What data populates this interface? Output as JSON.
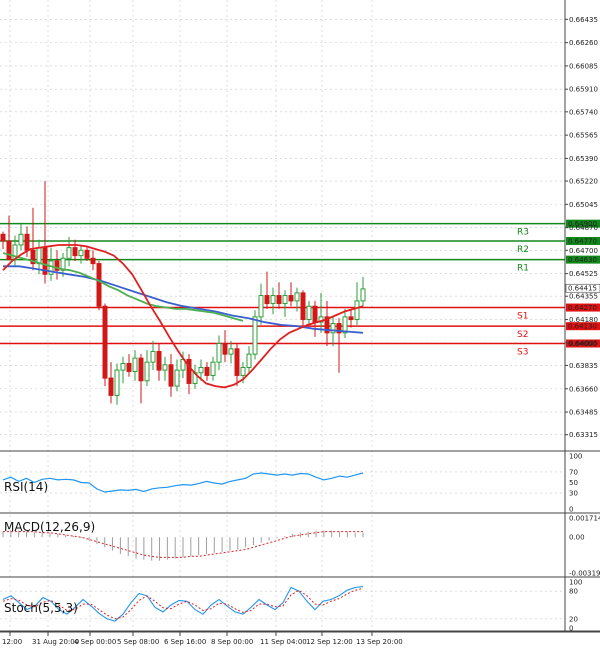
{
  "colors": {
    "resistance": "#11881a",
    "support": "#e01010",
    "ma_fast": "#e02020",
    "ma_mid": "#4caf50",
    "ma_slow": "#3a5fcf",
    "up": "#2e9e3a",
    "down": "#d01818",
    "rsi": "#2196f3",
    "macd_signal": "#e02020",
    "macd_hist": "#9e9e9e",
    "stoch_k": "#2196f3",
    "stoch_d": "#e02020"
  },
  "chart_data": [
    {
      "type": "candlestick",
      "panel": "price",
      "y_ticks": [
        "0.66435",
        "0.66260",
        "0.66085",
        "0.65910",
        "0.65740",
        "0.65565",
        "0.65390",
        "0.65220",
        "0.65045",
        "0.64870",
        "0.64700",
        "0.64525",
        "0.64355",
        "0.64180",
        "0.64005",
        "0.63835",
        "0.63660",
        "0.63485",
        "0.63315"
      ],
      "ylim": [
        0.6323,
        0.6652
      ],
      "x_ticks": [
        "12:00",
        "31 Aug 20:00",
        "4 Sep 00:00",
        "5 Sep 08:00",
        "6 Sep 16:00",
        "8 Sep 00:00",
        "11 Sep 04:00",
        "12 Sep 12:00",
        "13 Sep 20:00"
      ],
      "levels": [
        {
          "label": "R3",
          "value": 0.649,
          "tag": "0.64900",
          "kind": "resistance"
        },
        {
          "label": "R2",
          "value": 0.6477,
          "tag": "0.64770",
          "kind": "resistance"
        },
        {
          "label": "R1",
          "value": 0.6463,
          "tag": "0.64630",
          "kind": "resistance"
        },
        {
          "label": "S1",
          "value": 0.6427,
          "tag": "0.64270",
          "kind": "support"
        },
        {
          "label": "S2",
          "value": 0.6413,
          "tag": "0.64130",
          "kind": "support"
        },
        {
          "label": "S3",
          "value": 0.64,
          "tag": "0.64000",
          "kind": "support"
        }
      ],
      "last_price": {
        "value": 0.64415,
        "tag": "0.64415"
      },
      "candles": [
        [
          0.6482,
          0.6484,
          0.6471,
          0.6477
        ],
        [
          0.6477,
          0.6496,
          0.6468,
          0.6463
        ],
        [
          0.6463,
          0.6481,
          0.6458,
          0.6474
        ],
        [
          0.6474,
          0.649,
          0.647,
          0.6482
        ],
        [
          0.6482,
          0.6488,
          0.6465,
          0.647
        ],
        [
          0.647,
          0.6502,
          0.6455,
          0.646
        ],
        [
          0.646,
          0.6478,
          0.6452,
          0.6472
        ],
        [
          0.6472,
          0.6522,
          0.6445,
          0.6452
        ],
        [
          0.6452,
          0.6472,
          0.6447,
          0.6462
        ],
        [
          0.6462,
          0.647,
          0.6448,
          0.6455
        ],
        [
          0.6455,
          0.6468,
          0.645,
          0.6464
        ],
        [
          0.6464,
          0.648,
          0.6458,
          0.6472
        ],
        [
          0.6472,
          0.6478,
          0.6462,
          0.6466
        ],
        [
          0.6466,
          0.6474,
          0.646,
          0.647
        ],
        [
          0.647,
          0.6472,
          0.6462,
          0.6464
        ],
        [
          0.6464,
          0.647,
          0.6455,
          0.646
        ],
        [
          0.646,
          0.6462,
          0.6425,
          0.6428
        ],
        [
          0.6428,
          0.643,
          0.6368,
          0.6374
        ],
        [
          0.6374,
          0.6386,
          0.6355,
          0.6361
        ],
        [
          0.6361,
          0.6385,
          0.6354,
          0.638
        ],
        [
          0.638,
          0.639,
          0.637,
          0.6385
        ],
        [
          0.6385,
          0.6392,
          0.6375,
          0.6379
        ],
        [
          0.6379,
          0.6395,
          0.6372,
          0.6389
        ],
        [
          0.6389,
          0.6392,
          0.6355,
          0.6372
        ],
        [
          0.6372,
          0.6395,
          0.6368,
          0.6386
        ],
        [
          0.6386,
          0.6402,
          0.638,
          0.6394
        ],
        [
          0.6394,
          0.64,
          0.6372,
          0.638
        ],
        [
          0.638,
          0.639,
          0.6372,
          0.6384
        ],
        [
          0.6384,
          0.6392,
          0.636,
          0.6368
        ],
        [
          0.6368,
          0.6388,
          0.6364,
          0.638
        ],
        [
          0.638,
          0.6394,
          0.6374,
          0.6388
        ],
        [
          0.6388,
          0.6392,
          0.6362,
          0.637
        ],
        [
          0.637,
          0.6384,
          0.6366,
          0.6378
        ],
        [
          0.6378,
          0.6388,
          0.6372,
          0.6382
        ],
        [
          0.6382,
          0.6386,
          0.6372,
          0.6376
        ],
        [
          0.6376,
          0.639,
          0.6372,
          0.6386
        ],
        [
          0.6386,
          0.6406,
          0.638,
          0.64
        ],
        [
          0.64,
          0.641,
          0.6386,
          0.6392
        ],
        [
          0.6392,
          0.6402,
          0.6385,
          0.6396
        ],
        [
          0.6396,
          0.64,
          0.6368,
          0.6376
        ],
        [
          0.6376,
          0.6386,
          0.637,
          0.6382
        ],
        [
          0.6382,
          0.6398,
          0.6378,
          0.6392
        ],
        [
          0.6392,
          0.6425,
          0.6388,
          0.642
        ],
        [
          0.642,
          0.6445,
          0.6414,
          0.6436
        ],
        [
          0.6436,
          0.6454,
          0.6426,
          0.643
        ],
        [
          0.643,
          0.6442,
          0.6422,
          0.6436
        ],
        [
          0.6436,
          0.6446,
          0.6426,
          0.643
        ],
        [
          0.643,
          0.644,
          0.642,
          0.6436
        ],
        [
          0.6436,
          0.6446,
          0.6428,
          0.6432
        ],
        [
          0.6432,
          0.6442,
          0.6424,
          0.6438
        ],
        [
          0.6438,
          0.644,
          0.6412,
          0.6418
        ],
        [
          0.6418,
          0.6432,
          0.6414,
          0.6428
        ],
        [
          0.6428,
          0.6432,
          0.6405,
          0.6416
        ],
        [
          0.6416,
          0.6438,
          0.6408,
          0.642
        ],
        [
          0.642,
          0.6432,
          0.6398,
          0.6408
        ],
        [
          0.6408,
          0.642,
          0.6398,
          0.6415
        ],
        [
          0.6415,
          0.6419,
          0.6378,
          0.6408
        ],
        [
          0.6408,
          0.6426,
          0.6404,
          0.642
        ],
        [
          0.642,
          0.6426,
          0.6412,
          0.6418
        ],
        [
          0.6418,
          0.6446,
          0.6414,
          0.6432
        ],
        [
          0.6432,
          0.645,
          0.6428,
          0.6441
        ]
      ],
      "ma_fast": [
        0.6455,
        0.6462,
        0.6467,
        0.6471,
        0.6472,
        0.6473,
        0.6474,
        0.6474,
        0.6474,
        0.6473,
        0.6471,
        0.6469,
        0.6466,
        0.646,
        0.6452,
        0.644,
        0.6428,
        0.6417,
        0.6405,
        0.6394,
        0.6384,
        0.6376,
        0.637,
        0.6368,
        0.6367,
        0.6369,
        0.6373,
        0.638,
        0.6388,
        0.6396,
        0.6403,
        0.6408,
        0.6411,
        0.6414,
        0.6416,
        0.6418,
        0.6421,
        0.6424,
        0.6426,
        0.6428
      ],
      "ma_mid": [
        0.6468,
        0.6466,
        0.6464,
        0.6462,
        0.646,
        0.6458,
        0.6456,
        0.6455,
        0.6453,
        0.645,
        0.6447,
        0.6443,
        0.644,
        0.6436,
        0.6433,
        0.643,
        0.6428,
        0.6427,
        0.6426,
        0.6426,
        0.6425,
        0.6424,
        0.6423,
        0.6421,
        0.6419,
        0.6417
      ],
      "ma_slow": [
        0.6458,
        0.6458,
        0.6456,
        0.6454,
        0.6452,
        0.645,
        0.6447,
        0.6443,
        0.6439,
        0.6435,
        0.6431,
        0.6428,
        0.6426,
        0.6424,
        0.6421,
        0.6419,
        0.6416,
        0.6414,
        0.6413,
        0.6411,
        0.641,
        0.6409,
        0.6408
      ]
    },
    {
      "type": "line",
      "panel": "rsi",
      "name": "RSI(14)",
      "y_ticks": [
        "100",
        "70",
        "50",
        "30",
        "0"
      ],
      "ylim": [
        0,
        100
      ],
      "values": [
        55,
        60,
        52,
        58,
        50,
        56,
        58,
        55,
        56,
        55,
        50,
        49,
        38,
        32,
        34,
        36,
        35,
        37,
        33,
        38,
        40,
        41,
        44,
        46,
        45,
        48,
        52,
        49,
        47,
        52,
        55,
        58,
        66,
        68,
        66,
        64,
        66,
        64,
        67,
        66,
        60,
        55,
        58,
        62,
        60,
        64,
        68
      ]
    },
    {
      "type": "bar+line",
      "panel": "macd",
      "name": "MACD(12,26,9)",
      "y_ticks": [
        "0.001714",
        "0.00",
        "-0.003195"
      ],
      "ylim": [
        -0.003195,
        0.001714
      ],
      "histogram": [
        0.0005,
        0.0006,
        0.0006,
        0.0005,
        0.0005,
        0.0004,
        0.0004,
        0.0003,
        0.0002,
        0.0001,
        -0.0001,
        -0.0003,
        -0.0006,
        -0.0009,
        -0.0012,
        -0.0015,
        -0.0017,
        -0.0019,
        -0.002,
        -0.0021,
        -0.0021,
        -0.002,
        -0.0019,
        -0.0018,
        -0.0017,
        -0.0016,
        -0.0015,
        -0.0014,
        -0.0013,
        -0.0012,
        -0.0011,
        -0.0009,
        -0.0007,
        -0.0005,
        -0.0003,
        -0.0001,
        0.0001,
        0.0003,
        0.0004,
        0.0005,
        0.0006,
        0.0006,
        0.0006,
        0.0005,
        0.0005,
        0.0004,
        0.0004
      ],
      "signal": [
        0.0005,
        0.0005,
        0.0005,
        0.0005,
        0.0005,
        0.0004,
        0.0004,
        0.0003,
        0.0002,
        0.0001,
        0.0,
        -0.0002,
        -0.0004,
        -0.0006,
        -0.0008,
        -0.001,
        -0.0012,
        -0.0014,
        -0.0016,
        -0.0017,
        -0.0018,
        -0.0018,
        -0.0018,
        -0.0018,
        -0.0017,
        -0.0017,
        -0.0016,
        -0.0015,
        -0.0014,
        -0.0013,
        -0.0012,
        -0.0011,
        -0.0009,
        -0.0007,
        -0.0005,
        -0.0003,
        -0.0001,
        0.0001,
        0.0002,
        0.0003,
        0.0004,
        0.0005,
        0.0005,
        0.0005,
        0.0005,
        0.0005,
        0.0005
      ]
    },
    {
      "type": "line",
      "panel": "stoch",
      "name": "Stoch(5,5,3)",
      "y_ticks": [
        "100",
        "80",
        "20",
        "0"
      ],
      "ylim": [
        0,
        100
      ],
      "k": [
        62,
        70,
        55,
        40,
        48,
        66,
        58,
        40,
        30,
        45,
        62,
        48,
        32,
        20,
        15,
        30,
        55,
        75,
        70,
        45,
        35,
        50,
        60,
        58,
        40,
        30,
        50,
        62,
        48,
        35,
        30,
        45,
        62,
        50,
        40,
        55,
        88,
        80,
        58,
        40,
        58,
        62,
        70,
        82,
        88,
        90
      ],
      "d": [
        58,
        64,
        60,
        50,
        46,
        56,
        60,
        50,
        38,
        40,
        52,
        52,
        40,
        28,
        20,
        24,
        40,
        60,
        70,
        58,
        44,
        42,
        52,
        58,
        50,
        38,
        42,
        54,
        52,
        42,
        34,
        38,
        52,
        52,
        46,
        48,
        72,
        82,
        70,
        52,
        50,
        58,
        64,
        74,
        82,
        86
      ]
    }
  ]
}
